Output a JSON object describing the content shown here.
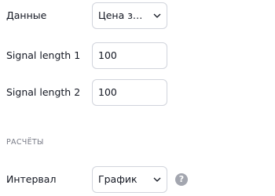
{
  "fields": [
    {
      "label": "Данные",
      "value": "Цена за...",
      "type": "select"
    },
    {
      "label": "Signal length 1",
      "value": "100",
      "type": "input"
    },
    {
      "label": "Signal length 2",
      "value": "100",
      "type": "input"
    }
  ],
  "section": {
    "title": "РАСЧЁТЫ"
  },
  "interval": {
    "label": "Интервал",
    "value": "График",
    "help_icon": "?"
  },
  "icons": {
    "chevron": "chevron-down-icon",
    "help": "question-circle-icon"
  },
  "colors": {
    "text": "#131722",
    "muted": "#787b86",
    "border": "#d1d4dc",
    "help": "#a3a6af"
  }
}
